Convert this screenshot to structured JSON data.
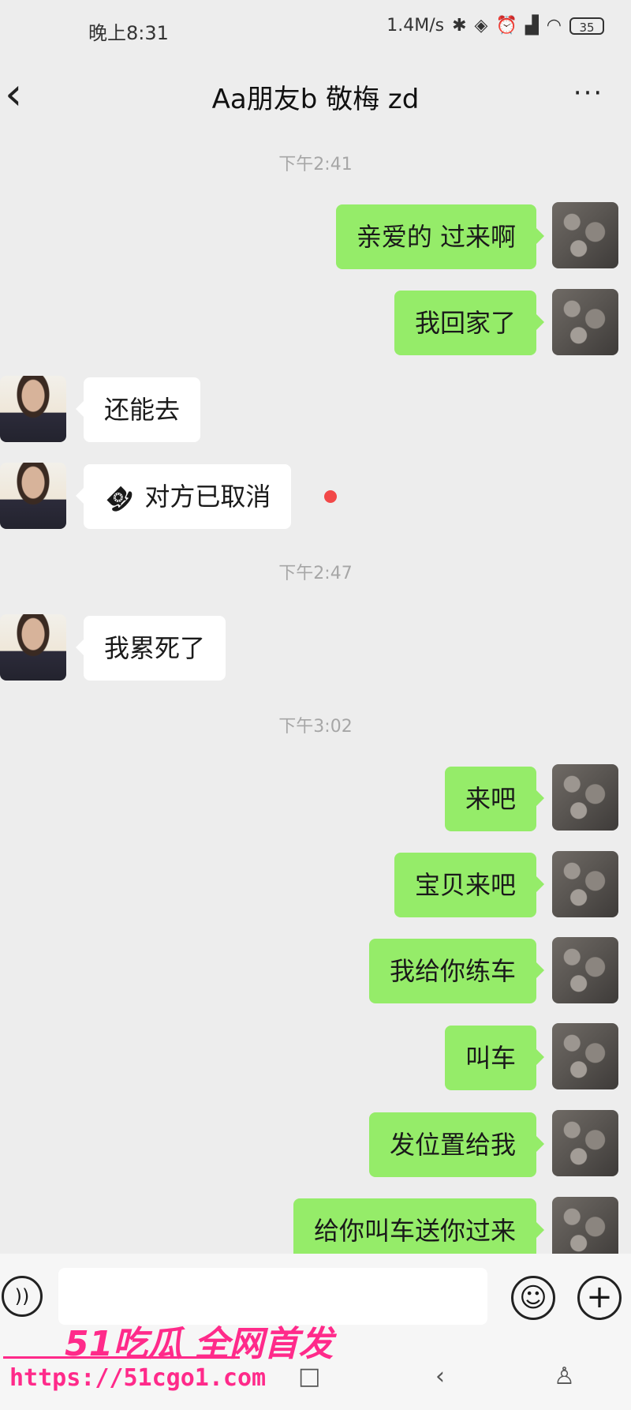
{
  "status_bar": {
    "time": "晚上8:31",
    "network_speed": "1.4M/s",
    "battery": "35",
    "icons": [
      "bluetooth-icon",
      "vibrate-icon",
      "alarm-icon",
      "signal-icon",
      "wifi-icon",
      "battery-icon"
    ]
  },
  "header": {
    "back_icon": "‹",
    "title": "Aa朋友b 敬梅 zd",
    "more_icon": "···"
  },
  "timestamps": [
    "下午2:41",
    "下午2:47",
    "下午3:02"
  ],
  "messages": [
    {
      "side": "out",
      "text": "亲爱的 过来啊"
    },
    {
      "side": "out",
      "text": "我回家了"
    },
    {
      "side": "in",
      "text": "还能去"
    },
    {
      "side": "in",
      "type": "call",
      "text": "对方已取消"
    },
    {
      "side": "in",
      "text": "我累死了"
    },
    {
      "side": "out",
      "text": "来吧"
    },
    {
      "side": "out",
      "text": "宝贝来吧"
    },
    {
      "side": "out",
      "text": "我给你练车"
    },
    {
      "side": "out",
      "text": "叫车"
    },
    {
      "side": "out",
      "text": "发位置给我"
    },
    {
      "side": "out",
      "text": "给你叫车送你过来"
    }
  ],
  "input_bar": {
    "voice_icon": "voice-icon",
    "emoji_icon": "emoji-icon",
    "plus_icon": "plus-icon"
  },
  "watermark": {
    "logo_text": "51吃瓜 全网首发",
    "url": "https://51cgo1.com"
  },
  "colors": {
    "background": "#ededed",
    "outgoing_bubble": "#95ec69",
    "incoming_bubble": "#ffffff",
    "unread_dot": "#f24848",
    "watermark": "#ff2a8a"
  }
}
